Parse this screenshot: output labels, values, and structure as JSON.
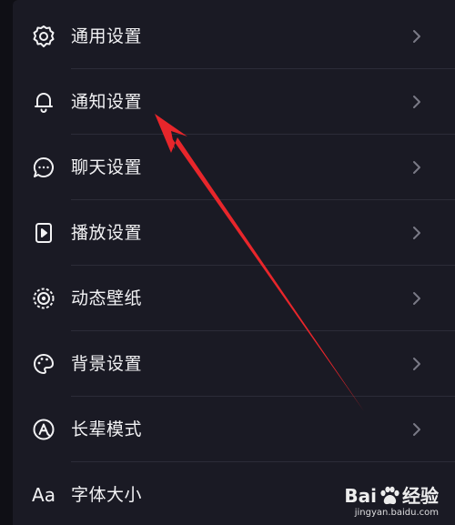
{
  "settings": {
    "items": [
      {
        "label": "通用设置",
        "icon": "gear-icon"
      },
      {
        "label": "通知设置",
        "icon": "bell-icon"
      },
      {
        "label": "聊天设置",
        "icon": "chat-bubble-icon"
      },
      {
        "label": "播放设置",
        "icon": "play-device-icon"
      },
      {
        "label": "动态壁纸",
        "icon": "live-wallpaper-icon"
      },
      {
        "label": "背景设置",
        "icon": "palette-icon"
      },
      {
        "label": "长辈模式",
        "icon": "elder-mode-icon"
      },
      {
        "label": "字体大小",
        "icon": "font-size-icon"
      }
    ],
    "font_icon_text": "Aa"
  },
  "watermark": {
    "brand": "Bai",
    "brand_suffix": "经验",
    "url": "jingyan.baidu.com"
  },
  "colors": {
    "background": "#0f0f15",
    "panel": "#1a1a24",
    "text": "#f2f2f4",
    "chevron": "#7a7a86",
    "divider": "#2c2c38",
    "annotation_arrow": "#e8262b"
  }
}
